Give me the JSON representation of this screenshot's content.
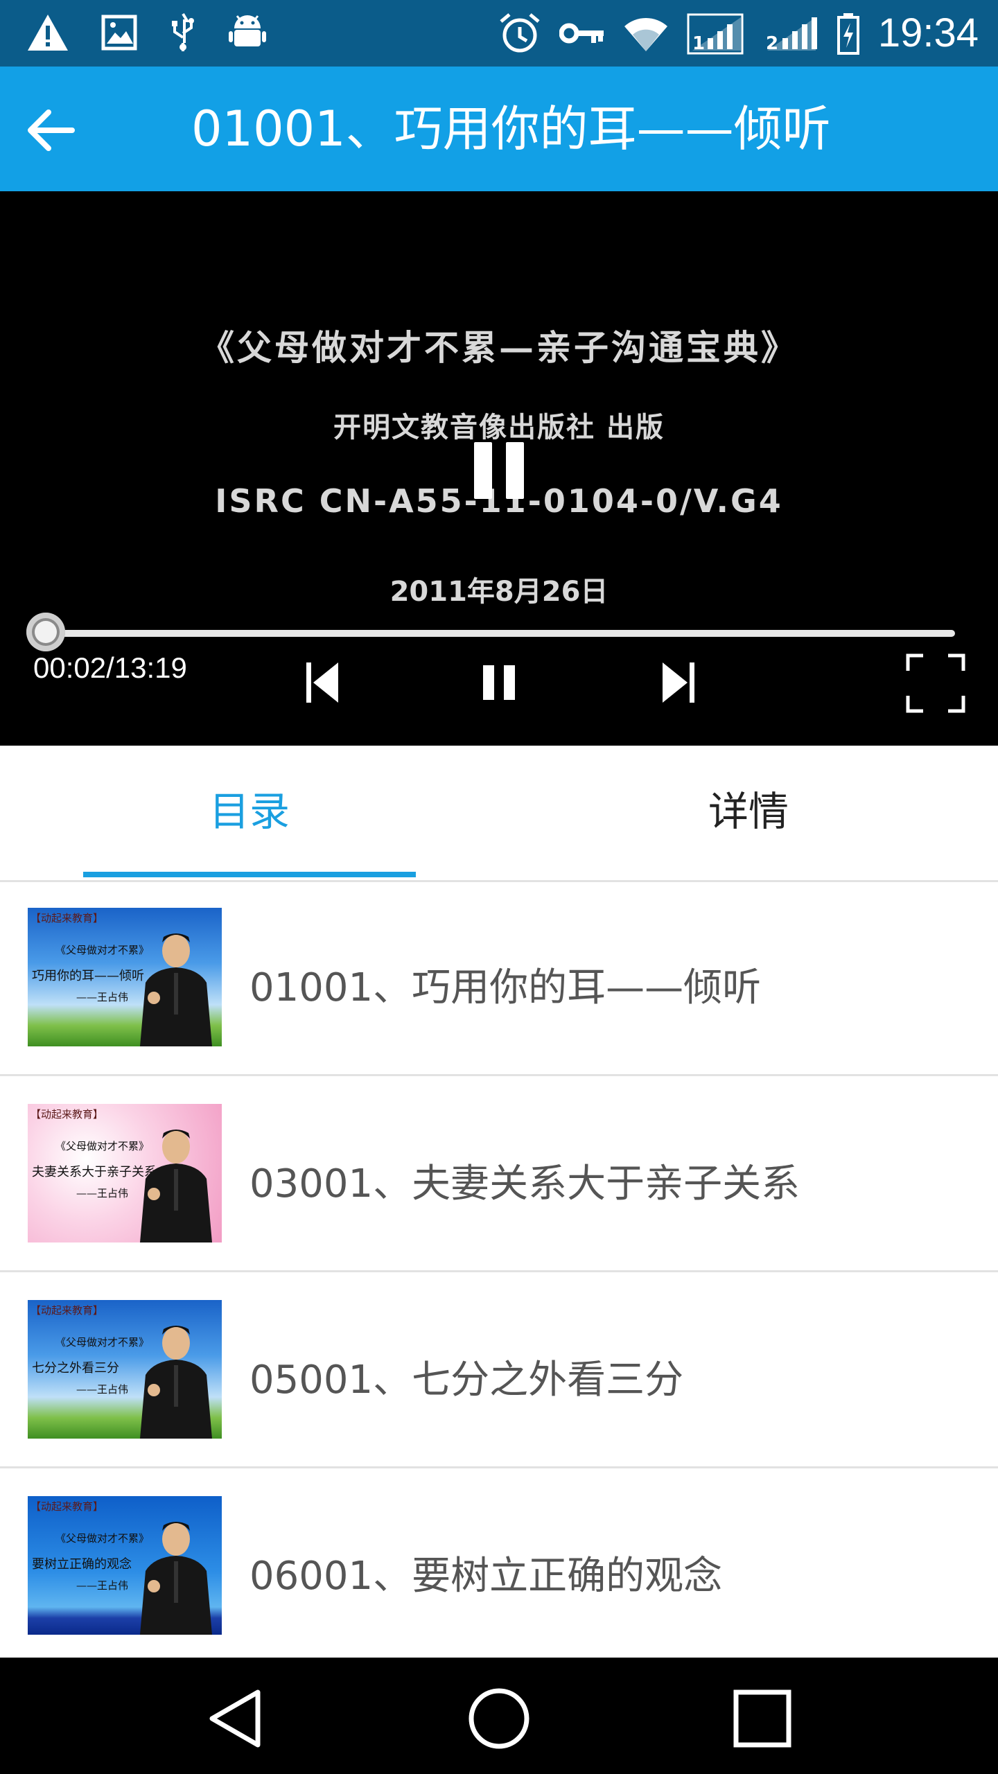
{
  "status_bar": {
    "time": "19:34",
    "left_icons": [
      "warning-icon",
      "image-icon",
      "usb-icon",
      "android-debug-icon"
    ],
    "right_icons": [
      "alarm-icon",
      "vpn-key-icon",
      "wifi-icon",
      "sim1-signal-icon",
      "sim2-signal-icon",
      "battery-charging-icon"
    ],
    "sim1_label": "1",
    "sim2_label": "2"
  },
  "app_bar": {
    "back_icon": "arrow-back-icon",
    "title": "01001、巧用你的耳——倾听"
  },
  "player": {
    "video_frame": {
      "line1": "《父母做对才不累—亲子沟通宝典》",
      "line2": "开明文教音像出版社   出版",
      "line3": "ISRC CN-A55-11-0104-0/V.G4",
      "line4": "2011年8月26日"
    },
    "progress": {
      "current": "00:02",
      "total": "13:19",
      "fraction": 0.003
    },
    "time_readout": "00:02/13:19",
    "controls": [
      "skip-previous-icon",
      "pause-icon",
      "skip-next-icon",
      "fullscreen-icon"
    ]
  },
  "tabs": [
    {
      "label": "目录",
      "active": true
    },
    {
      "label": "详情",
      "active": false
    }
  ],
  "playlist": [
    {
      "title": "01001、巧用你的耳——倾听",
      "thumb": {
        "tag": "【动起来教育】",
        "series": "《父母做对才不累》",
        "subtitle": "巧用你的耳——倾听",
        "author": "——王占伟",
        "bg": "sky"
      }
    },
    {
      "title": "03001、夫妻关系大于亲子关系",
      "thumb": {
        "tag": "【动起来教育】",
        "series": "《父母做对才不累》",
        "subtitle": "夫妻关系大于亲子关系",
        "author": "——王占伟",
        "bg": "pink"
      }
    },
    {
      "title": "05001、七分之外看三分",
      "thumb": {
        "tag": "【动起来教育】",
        "series": "《父母做对才不累》",
        "subtitle": "七分之外看三分",
        "author": "——王占伟",
        "bg": "sky"
      }
    },
    {
      "title": "06001、要树立正确的观念",
      "thumb": {
        "tag": "【动起来教育】",
        "series": "《父母做对才不累》",
        "subtitle": "要树立正确的观念",
        "author": "——王占伟",
        "bg": "blue"
      }
    }
  ],
  "nav_bar": [
    "back-triangle-icon",
    "home-circle-icon",
    "recents-square-icon"
  ],
  "colors": {
    "status_bar": "#0b5c8a",
    "app_bar": "#12a0e6",
    "accent": "#1a9fe0",
    "player_bg": "#000000"
  }
}
